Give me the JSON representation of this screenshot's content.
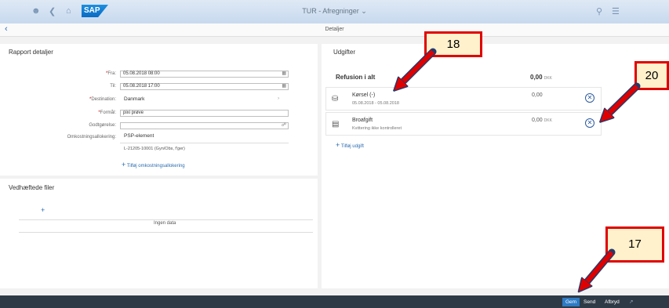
{
  "shell": {
    "title": "TUR - Afregninger",
    "logo": "SAP",
    "icons": [
      "user-icon",
      "back-icon",
      "home-icon",
      "search-icon",
      "menu-icon"
    ]
  },
  "subheader": {
    "title": "Detaljer"
  },
  "report": {
    "title": "Rapport detaljer",
    "fields": [
      {
        "label": "Fra:",
        "required": true,
        "value": "05.08.2018 08:00"
      },
      {
        "label": "Til:",
        "required": false,
        "value": "05.08.2018 17:00"
      },
      {
        "label": "Destination:",
        "required": true,
        "value": "Danmark"
      },
      {
        "label": "Formål:",
        "required": true,
        "value": "pixi prøve"
      },
      {
        "label": "Godtgørelse:",
        "required": false,
        "value": ""
      }
    ],
    "allocation_label": "Omkostningsallokering:",
    "allocation_type": "PSP-element",
    "allocation_value": "L-21205-10001 (Gyn/Obs, f'ger)",
    "add_allocation": "Tilføj omkostningsallokering"
  },
  "attachments": {
    "title": "Vedhæftede filer",
    "empty": "Ingen data"
  },
  "expenses": {
    "title": "Udgifter",
    "total_label": "Refusion i alt",
    "total_value": "0,00",
    "total_currency": "DKK",
    "items": [
      {
        "name": "Kørsel (-)",
        "sub": "05.08.2018 - 05.08.2018",
        "amount": "0,00",
        "currency": ""
      },
      {
        "name": "Broafgift",
        "sub": "Kvittering ikke kontrolleret",
        "amount": "0,00",
        "currency": "DKK"
      }
    ],
    "add_expense": "Tilføj udgift"
  },
  "footer": {
    "save": "Gem",
    "send": "Send",
    "cancel": "Afbryd"
  },
  "annotations": {
    "c18": "18",
    "c20": "20",
    "c17": "17"
  },
  "colors": {
    "shell": "#c7d9ee",
    "accent": "#2b6cb0",
    "footer": "#2f3a47",
    "annotation": "#e00000"
  }
}
